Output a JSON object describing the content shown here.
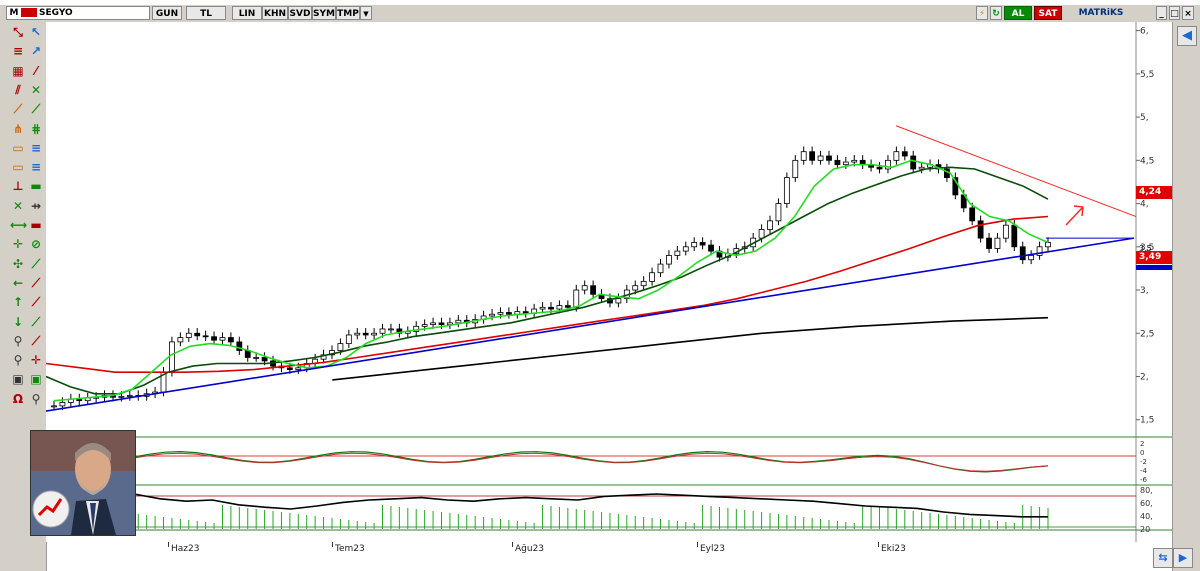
{
  "toolbar": {
    "logo": "M",
    "symbol": "SEGYO",
    "buttons": [
      "GUN",
      "TL",
      "LIN",
      "KHN",
      "SVD",
      "SYM",
      "TMP"
    ],
    "buy_label": "AL",
    "sell_label": "SAT",
    "brand": "MATRiKS"
  },
  "price_axis": {
    "ticks": [
      "6,",
      "5,5",
      "5,",
      "4,5",
      "4,",
      "3,5",
      "3,",
      "2,5",
      "2,",
      "1,5"
    ],
    "ticks_values": [
      6,
      5.5,
      5,
      4.5,
      4,
      3.5,
      3,
      2.5,
      2,
      1.5
    ],
    "tag_upper": "4,24",
    "tag_lower": "3,49",
    "tag_partial": "3,5"
  },
  "osc_axis": {
    "ticks": [
      "2",
      "0",
      "-2",
      "-4",
      "-6"
    ]
  },
  "rsi_axis": {
    "ticks": [
      "80,",
      "60,",
      "40,",
      "20"
    ]
  },
  "x_axis": {
    "labels": [
      "Haz23",
      "Tem23",
      "Ağu23",
      "Eyl23",
      "Eki23"
    ]
  },
  "chart_data": {
    "type": "line",
    "title": "SEGYO",
    "ylim": [
      1.3,
      6.1
    ],
    "candles_close": [
      1.66,
      1.7,
      1.74,
      1.72,
      1.75,
      1.76,
      1.78,
      1.76,
      1.77,
      1.78,
      1.77,
      1.8,
      1.82,
      2.05,
      2.4,
      2.45,
      2.5,
      2.47,
      2.46,
      2.42,
      2.45,
      2.4,
      2.3,
      2.22,
      2.22,
      2.18,
      2.12,
      2.1,
      2.08,
      2.1,
      2.15,
      2.2,
      2.25,
      2.3,
      2.38,
      2.48,
      2.5,
      2.48,
      2.5,
      2.55,
      2.55,
      2.5,
      2.52,
      2.58,
      2.6,
      2.62,
      2.6,
      2.62,
      2.65,
      2.62,
      2.66,
      2.7,
      2.72,
      2.74,
      2.72,
      2.75,
      2.73,
      2.78,
      2.8,
      2.78,
      2.82,
      2.8,
      3.0,
      3.05,
      2.95,
      2.9,
      2.85,
      2.9,
      3.0,
      3.05,
      3.1,
      3.2,
      3.3,
      3.4,
      3.45,
      3.5,
      3.55,
      3.52,
      3.45,
      3.38,
      3.42,
      3.48,
      3.5,
      3.6,
      3.7,
      3.8,
      4.0,
      4.3,
      4.5,
      4.6,
      4.5,
      4.55,
      4.5,
      4.45,
      4.48,
      4.5,
      4.45,
      4.42,
      4.4,
      4.5,
      4.6,
      4.55,
      4.4,
      4.42,
      4.45,
      4.4,
      4.3,
      4.1,
      3.95,
      3.8,
      3.6,
      3.48,
      3.6,
      3.75,
      3.5,
      3.35,
      3.4,
      3.5,
      3.55
    ],
    "series": [
      {
        "name": "MA short",
        "color": "#22dd22"
      },
      {
        "name": "MA mid",
        "color": "#0a4a0a"
      },
      {
        "name": "MA long",
        "color": "#dd0000"
      },
      {
        "name": "MA longest",
        "color": "#000000"
      },
      {
        "name": "trendline support",
        "color": "#0000cc"
      },
      {
        "name": "trendline resistance",
        "color": "#ff2020"
      }
    ],
    "ma_short": [
      1.72,
      1.74,
      1.76,
      1.78,
      1.85,
      2.05,
      2.25,
      2.35,
      2.38,
      2.36,
      2.3,
      2.22,
      2.15,
      2.1,
      2.12,
      2.22,
      2.38,
      2.48,
      2.52,
      2.55,
      2.58,
      2.62,
      2.66,
      2.7,
      2.72,
      2.74,
      2.76,
      2.82,
      2.95,
      2.92,
      2.9,
      3.0,
      3.15,
      3.32,
      3.45,
      3.4,
      3.45,
      3.6,
      3.85,
      4.2,
      4.4,
      4.45,
      4.45,
      4.42,
      4.5,
      4.45,
      4.35,
      4.0,
      3.85,
      3.8,
      3.65,
      3.55
    ],
    "ma_mid": [
      2.0,
      1.88,
      1.8,
      1.8,
      1.9,
      2.05,
      2.12,
      2.15,
      2.15,
      2.15,
      2.18,
      2.22,
      2.28,
      2.35,
      2.4,
      2.46,
      2.5,
      2.54,
      2.58,
      2.62,
      2.68,
      2.74,
      2.8,
      2.88,
      2.96,
      3.05,
      3.15,
      3.28,
      3.4,
      3.55,
      3.7,
      3.85,
      4.0,
      4.12,
      4.22,
      4.32,
      4.4,
      4.42,
      4.4,
      4.3,
      4.2,
      4.05
    ],
    "ma_long": [
      2.15,
      2.1,
      2.05,
      2.05,
      2.05,
      2.06,
      2.08,
      2.12,
      2.16,
      2.22,
      2.28,
      2.34,
      2.4,
      2.46,
      2.52,
      2.58,
      2.64,
      2.7,
      2.76,
      2.82,
      2.9,
      3.0,
      3.1,
      3.22,
      3.35,
      3.48,
      3.62,
      3.75,
      3.82,
      3.85
    ],
    "ma_longest": [
      1.96,
      2.02,
      2.08,
      2.14,
      2.2,
      2.26,
      2.32,
      2.38,
      2.44,
      2.5,
      2.54,
      2.58,
      2.61,
      2.64,
      2.66,
      2.68
    ],
    "support_line": [
      1.6,
      3.6
    ],
    "resistance_line": [
      4.9,
      3.85
    ]
  }
}
